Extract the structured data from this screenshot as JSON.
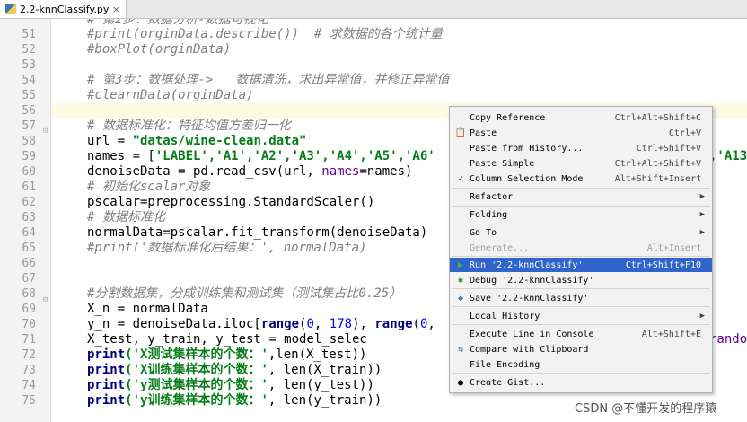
{
  "tab": {
    "title": "2.2-knnClassify.py"
  },
  "gutter": [
    "51",
    "52",
    "53",
    "54",
    "55",
    "56",
    "57",
    "58",
    "59",
    "60",
    "61",
    "62",
    "63",
    "64",
    "65",
    "66",
    "67",
    "68",
    "69",
    "70",
    "71",
    "72",
    "73",
    "74",
    "75"
  ],
  "code": {
    "l50": "# 第2步：数据分析-数据可视化",
    "l51": "#print(orginData.describe())  # 求数据的各个统计量",
    "l52": "#boxPlot(orginData)",
    "l54": "# 第3步：数据处理->   数据清洗，求出异常值，并修正异常值",
    "l55": "#clearnData(orginData)",
    "l57": "# 数据标准化：特征均值方差归一化",
    "l58a": "url = ",
    "l58b": "\"datas/wine-clean.data\"",
    "l59a": "names = [",
    "l59b": "'LABEL','A1','A2','A3','A4','A5','A6'",
    "l59c": ",'A13",
    "l60a": "denoiseData = pd.read_csv(url, ",
    "l60b": "names",
    "l60c": "=names)",
    "l61": "# 初始化scalar对象",
    "l62": "pscalar=preprocessing.StandardScaler()",
    "l63": "# 数据标准化",
    "l64": "normalData=pscalar.fit_transform(denoiseData)",
    "l65": "#print('数据标准化后结果：', normalData)",
    "l68": "#分割数据集，分成训练集和测试集（测试集占比0.25）",
    "l69": "X_n = normalData",
    "l70a": "y_n = denoiseData.iloc[",
    "l70b": "range",
    "l70c": "(",
    "l70d": "0",
    "l70e": ", ",
    "l70f": "178",
    "l70g": "), ",
    "l70h": "range",
    "l70i": "(",
    "l70j": "0",
    "l70k": ",",
    "l71a": "X_test, y_train, y_test = model_selec",
    "l71b": "random",
    "l72a": "print",
    "l72b": "('X测试集样本的个数：'",
    "l72c": ",len(X_test))",
    "l73a": "print",
    "l73b": "('X训练集样本的个数：'",
    "l73c": ", len(X_train))",
    "l74a": "print",
    "l74b": "('y测试集样本的个数：'",
    "l74c": ", len(y_test))",
    "l75a": "print",
    "l75b": "('y训练集样本的个数：'",
    "l75c": ", len(y_train))"
  },
  "menu": {
    "copy_reference": "Copy Reference",
    "copy_reference_sc": "Ctrl+Alt+Shift+C",
    "paste": "Paste",
    "paste_sc": "Ctrl+V",
    "paste_history": "Paste from History...",
    "paste_history_sc": "Ctrl+Shift+V",
    "paste_simple": "Paste Simple",
    "paste_simple_sc": "Ctrl+Alt+Shift+V",
    "column_mode": "Column Selection Mode",
    "column_mode_sc": "Alt+Shift+Insert",
    "refactor": "Refactor",
    "folding": "Folding",
    "goto": "Go To",
    "generate": "Generate...",
    "generate_sc": "Alt+Insert",
    "run": "Run '2.2-knnClassify'",
    "run_sc": "Ctrl+Shift+F10",
    "debug": "Debug '2.2-knnClassify'",
    "save": "Save '2.2-knnClassify'",
    "local_history": "Local History",
    "exec_console": "Execute Line in Console",
    "exec_console_sc": "Alt+Shift+E",
    "compare_clipboard": "Compare with Clipboard",
    "file_encoding": "File Encoding",
    "create_gist": "Create Gist..."
  },
  "watermark": "CSDN @不懂开发的程序猿",
  "colors": {
    "selection": "#2f65ca",
    "comment": "#808080",
    "string": "#067d17",
    "keyword": "#000080"
  }
}
